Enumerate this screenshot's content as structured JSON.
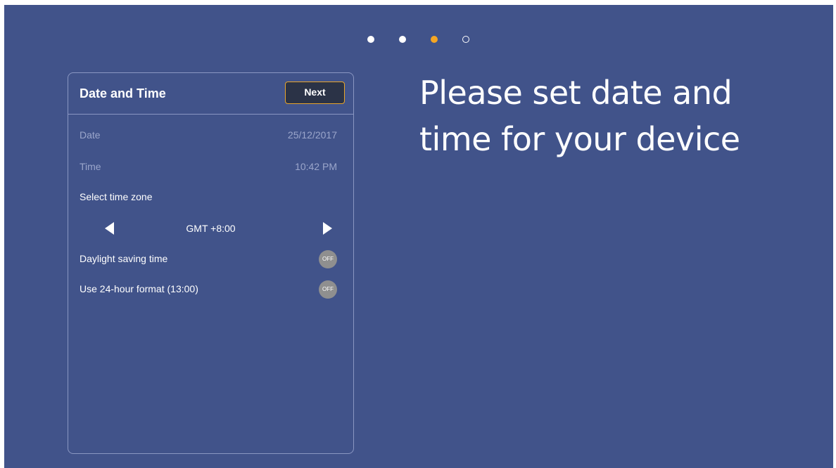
{
  "pagination": {
    "total_steps": 4,
    "current_step": 3
  },
  "panel": {
    "title": "Date and Time",
    "next_label": "Next",
    "date": {
      "label": "Date",
      "value": "25/12/2017"
    },
    "time": {
      "label": "Time",
      "value": "10:42 PM"
    },
    "timezone": {
      "label": "Select time zone",
      "value": "GMT +8:00"
    },
    "daylight_saving": {
      "label": "Daylight saving time",
      "state": "OFF"
    },
    "hour_format": {
      "label": "Use 24-hour format (13:00)",
      "state": "OFF"
    }
  },
  "headline": "Please set date and time for your device",
  "colors": {
    "background": "#41538a",
    "accent": "#f5a623",
    "toggle_off": "#8f8f8f"
  }
}
